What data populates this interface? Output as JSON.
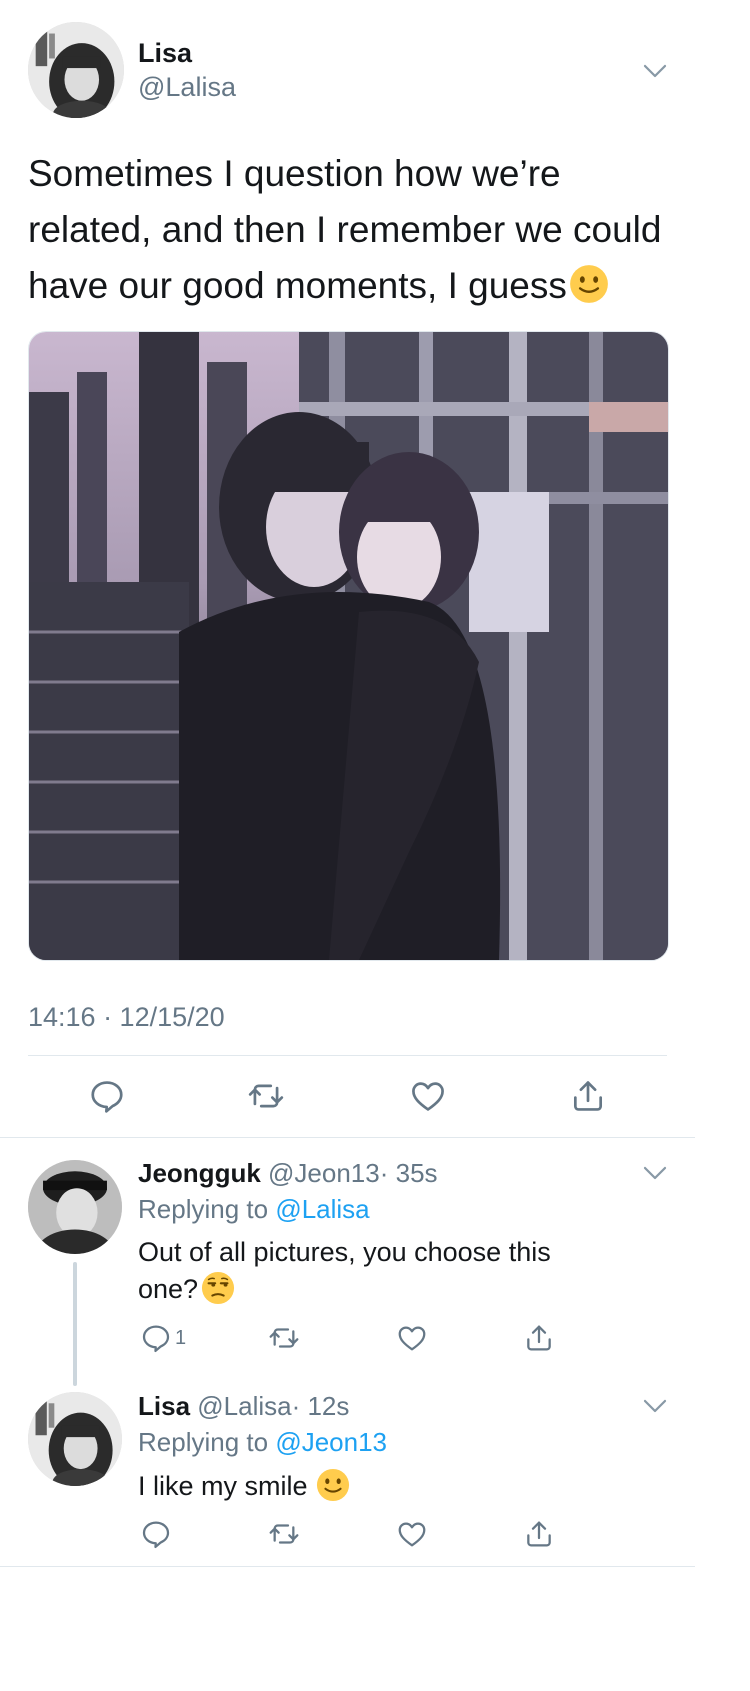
{
  "main_tweet": {
    "author_name": "Lisa",
    "author_handle": "@Lalisa",
    "text": "Sometimes I question how we’re related, and then I remember we could have our good moments, I guess",
    "emoji": "slightly-smiling-face",
    "photo_alt": "photo",
    "timestamp": "14:16 · 12/15/20"
  },
  "replies": [
    {
      "author_name": "Jeongguk",
      "author_handle": "@Jeon13",
      "age": "· 35s",
      "replying_prefix": "Replying to ",
      "replying_to": "@Lalisa",
      "text": "Out of all pictures, you choose this one?",
      "emoji": "unamused-face",
      "reply_count": "1"
    },
    {
      "author_name": "Lisa",
      "author_handle": "@Lalisa",
      "age": "· 12s",
      "replying_prefix": "Replying to ",
      "replying_to": "@Jeon13",
      "text": "I like my smile",
      "emoji": "slightly-smiling-face",
      "reply_count": ""
    }
  ],
  "colors": {
    "text": "#14171a",
    "muted": "#657786",
    "link": "#1da1f2",
    "divider": "#e1e8ed",
    "emoji_yellow": "#ffcc4d"
  },
  "icons": [
    "chevron-down-icon",
    "reply-icon",
    "retweet-icon",
    "like-icon",
    "share-icon"
  ]
}
